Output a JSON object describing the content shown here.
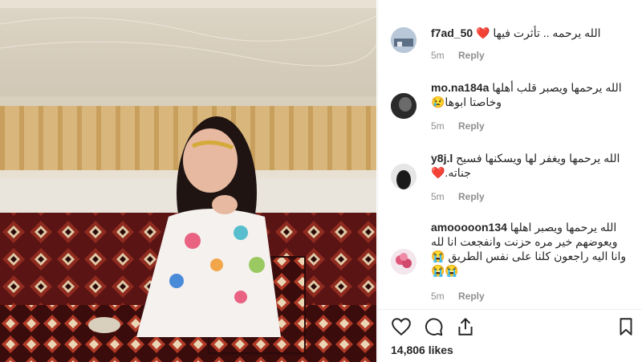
{
  "post": {
    "likes_text": "14,806 likes"
  },
  "comments": [
    {
      "username": "f7ad_50",
      "text": "الله يرحمه .. تأثرت فيها ❤️",
      "time": "5m",
      "reply": "Reply"
    },
    {
      "username": "mo.na184a",
      "text": "الله يرحمها ويصبر قلب أهلها وخاصتا ابوها😢",
      "time": "5m",
      "reply": "Reply"
    },
    {
      "username": "y8j.l",
      "text": "الله يرحمها ويغفر لها ويسكنها فسيح جناته.❤️",
      "time": "5m",
      "reply": "Reply"
    },
    {
      "username": "amooooon134",
      "text": "الله يرحمها ويصبر اهلها ويعوضهم خير مره حزنت وانفجعت انا لله وانا اليه راجعون كلنا على نفس الطريق 😭😭😭",
      "time": "5m",
      "reply": "Reply"
    }
  ],
  "icons": {
    "like": "heart-icon",
    "comment": "comment-icon",
    "share": "share-icon",
    "save": "bookmark-icon"
  }
}
